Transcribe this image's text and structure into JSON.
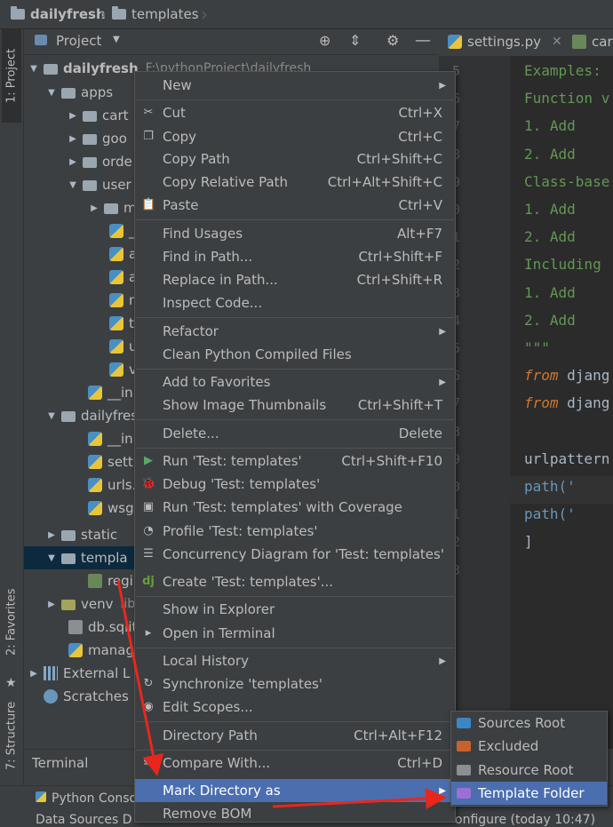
{
  "breadcrumb": [
    "dailyfresh",
    "templates"
  ],
  "left_tabs": {
    "project": "1: Project",
    "favorites": "2: Favorites",
    "structure": "7: Structure"
  },
  "project_header": {
    "title": "Project"
  },
  "tree": {
    "root_name": "dailyfresh",
    "root_path": "F:\\pythonProject\\dailyfresh",
    "items": [
      {
        "label": "apps"
      },
      {
        "label": "cart"
      },
      {
        "label": "goo"
      },
      {
        "label": "orde"
      },
      {
        "label": "user"
      },
      {
        "label": "m"
      },
      {
        "label": "_"
      },
      {
        "label": "a"
      },
      {
        "label": "a"
      },
      {
        "label": "m"
      },
      {
        "label": "t"
      },
      {
        "label": "u"
      },
      {
        "label": "v"
      },
      {
        "label": "__ini"
      },
      {
        "label": "dailyfres"
      },
      {
        "label": "__ini"
      },
      {
        "label": "setti"
      },
      {
        "label": "urls."
      },
      {
        "label": "wsg"
      },
      {
        "label": "static"
      },
      {
        "label": "templa"
      },
      {
        "label": "regi"
      },
      {
        "label": "venv"
      },
      {
        "label": "lib"
      },
      {
        "label": "db.sqlit"
      },
      {
        "label": "manage"
      },
      {
        "label": "External L"
      },
      {
        "label": "Scratches"
      }
    ]
  },
  "editor": {
    "tabs": [
      "settings.py",
      "car"
    ],
    "line_numbers": [
      "5",
      "6",
      "7",
      "8",
      "9",
      "0",
      "1",
      "2",
      "3",
      "4",
      "5",
      "6",
      "7",
      "8",
      "9",
      "0",
      "1",
      "2",
      "3"
    ],
    "code_lines": [
      {
        "text": "Examples:",
        "cls": "doc"
      },
      {
        "text": "Function v",
        "cls": "doc"
      },
      {
        "text": "    1. Add",
        "cls": "doc"
      },
      {
        "text": "    2. Add",
        "cls": "doc"
      },
      {
        "text": "Class-base",
        "cls": "doc"
      },
      {
        "text": "    1. Add",
        "cls": "doc"
      },
      {
        "text": "    2. Add",
        "cls": "doc"
      },
      {
        "text": "Including",
        "cls": "doc"
      },
      {
        "text": "    1. Add",
        "cls": "doc"
      },
      {
        "text": "    2. Add",
        "cls": "doc"
      },
      {
        "text": "\"\"\"",
        "cls": "doc"
      },
      {
        "text": "from djang",
        "cls": "mixed"
      },
      {
        "text": "from djang",
        "cls": "mixed"
      },
      {
        "text": "",
        "cls": "fn"
      },
      {
        "text": "urlpattern",
        "cls": "fn"
      },
      {
        "text": "    path('",
        "cls": "path"
      },
      {
        "text": "    path('",
        "cls": "path"
      },
      {
        "text": "]",
        "cls": "fn"
      }
    ]
  },
  "menu": {
    "items": [
      {
        "label": "New",
        "shortcut": "",
        "sub": true
      },
      {
        "label": "Cut",
        "shortcut": "Ctrl+X",
        "icon": "✂"
      },
      {
        "label": "Copy",
        "shortcut": "Ctrl+C",
        "icon": "❐"
      },
      {
        "label": "Copy Path",
        "shortcut": "Ctrl+Shift+C"
      },
      {
        "label": "Copy Relative Path",
        "shortcut": "Ctrl+Alt+Shift+C"
      },
      {
        "label": "Paste",
        "shortcut": "Ctrl+V",
        "icon": "📋"
      },
      {
        "label": "Find Usages",
        "shortcut": "Alt+F7"
      },
      {
        "label": "Find in Path...",
        "shortcut": "Ctrl+Shift+F"
      },
      {
        "label": "Replace in Path...",
        "shortcut": "Ctrl+Shift+R"
      },
      {
        "label": "Inspect Code...",
        "shortcut": ""
      },
      {
        "label": "Refactor",
        "shortcut": "",
        "sub": true
      },
      {
        "label": "Clean Python Compiled Files",
        "shortcut": ""
      },
      {
        "label": "Add to Favorites",
        "shortcut": "",
        "sub": true
      },
      {
        "label": "Show Image Thumbnails",
        "shortcut": "Ctrl+Shift+T"
      },
      {
        "label": "Delete...",
        "shortcut": "Delete"
      },
      {
        "label": "Run 'Test: templates'",
        "shortcut": "Ctrl+Shift+F10",
        "icon": "▶"
      },
      {
        "label": "Debug 'Test: templates'",
        "shortcut": "",
        "icon": "🐞"
      },
      {
        "label": "Run 'Test: templates' with Coverage",
        "shortcut": "",
        "icon": "▣"
      },
      {
        "label": "Profile 'Test: templates'",
        "shortcut": "",
        "icon": "◔"
      },
      {
        "label": "Concurrency Diagram for 'Test: templates'",
        "shortcut": "",
        "icon": "☰"
      },
      {
        "label": "Create 'Test: templates'...",
        "shortcut": "",
        "icon": "dj"
      },
      {
        "label": "Show in Explorer",
        "shortcut": ""
      },
      {
        "label": "Open in Terminal",
        "shortcut": "",
        "icon": "▸"
      },
      {
        "label": "Local History",
        "shortcut": "",
        "sub": true
      },
      {
        "label": "Synchronize 'templates'",
        "shortcut": "",
        "icon": "↻"
      },
      {
        "label": "Edit Scopes...",
        "shortcut": "",
        "icon": "◉"
      },
      {
        "label": "Directory Path",
        "shortcut": "Ctrl+Alt+F12"
      },
      {
        "label": "Compare With...",
        "shortcut": "Ctrl+D",
        "icon": "⇆"
      },
      {
        "label": "Mark Directory as",
        "shortcut": "",
        "sub": true
      },
      {
        "label": "Remove BOM",
        "shortcut": ""
      }
    ]
  },
  "submenu": {
    "items": [
      {
        "label": "Sources Root",
        "color": "#3d86c6"
      },
      {
        "label": "Excluded",
        "color": "#c7622e"
      },
      {
        "label": "Resource Root",
        "color": "#8a8f93"
      },
      {
        "label": "Template Folder",
        "color": "#9b6fd6"
      }
    ]
  },
  "bottom": {
    "terminal": "Terminal",
    "python_console": "Python Conso",
    "data_sources": "Data Sources D",
    "status": "onfigure (today 10:47)"
  },
  "colors": {
    "selection": "#4b6eaf",
    "annotation": "#e8271c"
  }
}
